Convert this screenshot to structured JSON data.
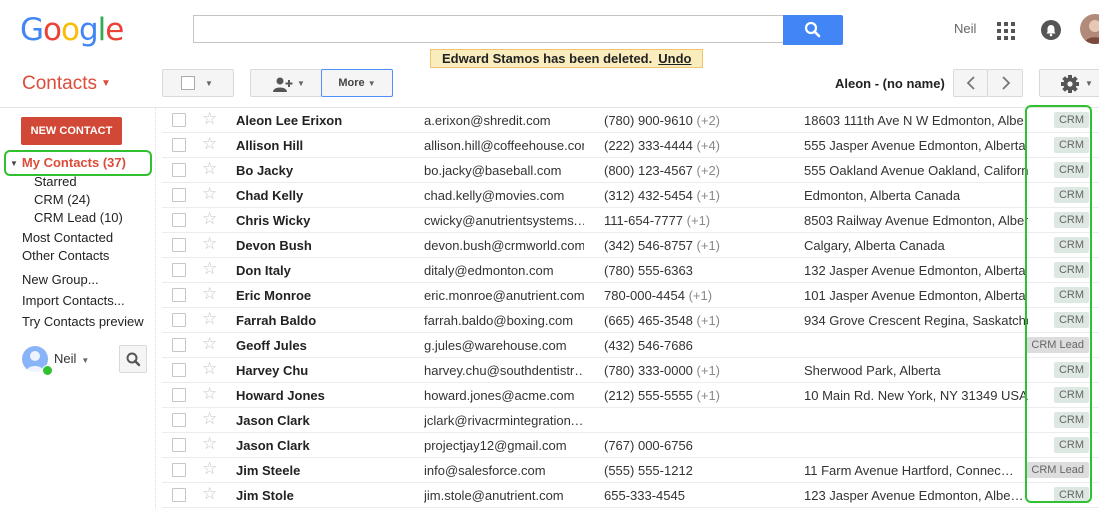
{
  "logo": "Google",
  "header": {
    "user_name": "Neil",
    "search": {
      "value": "",
      "placeholder": ""
    }
  },
  "toast": {
    "message": "Edward Stamos has been deleted.",
    "undo": "Undo"
  },
  "toolbar": {
    "title": "Contacts",
    "more_label": "More",
    "pager_label": "Aleon - (no name)"
  },
  "sidebar": {
    "new_contact": "NEW CONTACT",
    "my_contacts": "My Contacts (37)",
    "groups": [
      "Starred",
      "CRM (24)",
      "CRM Lead (10)"
    ],
    "links": [
      "Most Contacted",
      "Other Contacts"
    ],
    "actions": [
      "New Group...",
      "Import Contacts...",
      "Try Contacts preview"
    ],
    "user_name": "Neil"
  },
  "contacts": [
    {
      "name": "Aleon Lee Erixon",
      "email": "a.erixon@shredit.com",
      "phone": "(780) 900-9610",
      "extra": "(+2)",
      "address": "18603 111th Ave N W Edmonton, Albe…",
      "tag": "CRM"
    },
    {
      "name": "Allison Hill",
      "email": "allison.hill@coffeehouse.com",
      "phone": "(222) 333-4444",
      "extra": "(+4)",
      "address": "555 Jasper Avenue Edmonton, Alberta",
      "tag": "CRM"
    },
    {
      "name": "Bo Jacky",
      "email": "bo.jacky@baseball.com",
      "phone": "(800) 123-4567",
      "extra": "(+2)",
      "address": "555 Oakland Avenue Oakland, Californ…",
      "tag": "CRM"
    },
    {
      "name": "Chad Kelly",
      "email": "chad.kelly@movies.com",
      "phone": "(312) 432-5454",
      "extra": "(+1)",
      "address": "Edmonton, Alberta Canada",
      "tag": "CRM"
    },
    {
      "name": "Chris Wicky",
      "email": "cwicky@anutrientsystems.…",
      "phone": "111-654-7777",
      "extra": "(+1)",
      "address": "8503 Railway Avenue Edmonton, Alber…",
      "tag": "CRM"
    },
    {
      "name": "Devon Bush",
      "email": "devon.bush@crmworld.com",
      "phone": "(342) 546-8757",
      "extra": "(+1)",
      "address": "Calgary, Alberta Canada",
      "tag": "CRM"
    },
    {
      "name": "Don Italy",
      "email": "ditaly@edmonton.com",
      "phone": "(780) 555-6363",
      "extra": "",
      "address": "132 Jasper Avenue Edmonton, Alberta",
      "tag": "CRM"
    },
    {
      "name": "Eric Monroe",
      "email": "eric.monroe@anutrient.com",
      "phone": "780-000-4454",
      "extra": "(+1)",
      "address": "101 Jasper Avenue Edmonton, Alberta",
      "tag": "CRM"
    },
    {
      "name": "Farrah Baldo",
      "email": "farrah.baldo@boxing.com",
      "phone": "(665) 465-3548",
      "extra": "(+1)",
      "address": "934 Grove Crescent Regina, Saskatche…",
      "tag": "CRM"
    },
    {
      "name": "Geoff Jules",
      "email": "g.jules@warehouse.com",
      "phone": "(432) 546-7686",
      "extra": "",
      "address": "",
      "tag": "CRM Lead"
    },
    {
      "name": "Harvey Chu",
      "email": "harvey.chu@southdentistr…",
      "phone": "(780) 333-0000",
      "extra": "(+1)",
      "address": "Sherwood Park, Alberta",
      "tag": "CRM"
    },
    {
      "name": "Howard Jones",
      "email": "howard.jones@acme.com",
      "phone": "(212) 555-5555",
      "extra": "(+1)",
      "address": "10 Main Rd. New York, NY 31349 USA",
      "tag": "CRM"
    },
    {
      "name": "Jason Clark",
      "email": "jclark@rivacrmintegration.…",
      "phone": "",
      "extra": "",
      "address": "",
      "tag": "CRM"
    },
    {
      "name": "Jason Clark",
      "email": "projectjay12@gmail.com",
      "phone": "(767) 000-6756",
      "extra": "",
      "address": "",
      "tag": "CRM"
    },
    {
      "name": "Jim Steele",
      "email": "info@salesforce.com",
      "phone": "(555) 555-1212",
      "extra": "",
      "address": "11 Farm Avenue Hartford, Connec…",
      "tag": "CRM Lead"
    },
    {
      "name": "Jim Stole",
      "email": "jim.stole@anutrient.com",
      "phone": "655-333-4545",
      "extra": "",
      "address": "123 Jasper Avenue Edmonton, Albe…",
      "tag": "CRM"
    }
  ],
  "colors": {
    "accent_red": "#dd4b39",
    "button_red": "#d14836",
    "blue": "#4285f4",
    "highlight_green": "#2fc12f",
    "toast_bg": "#f9edbe"
  }
}
